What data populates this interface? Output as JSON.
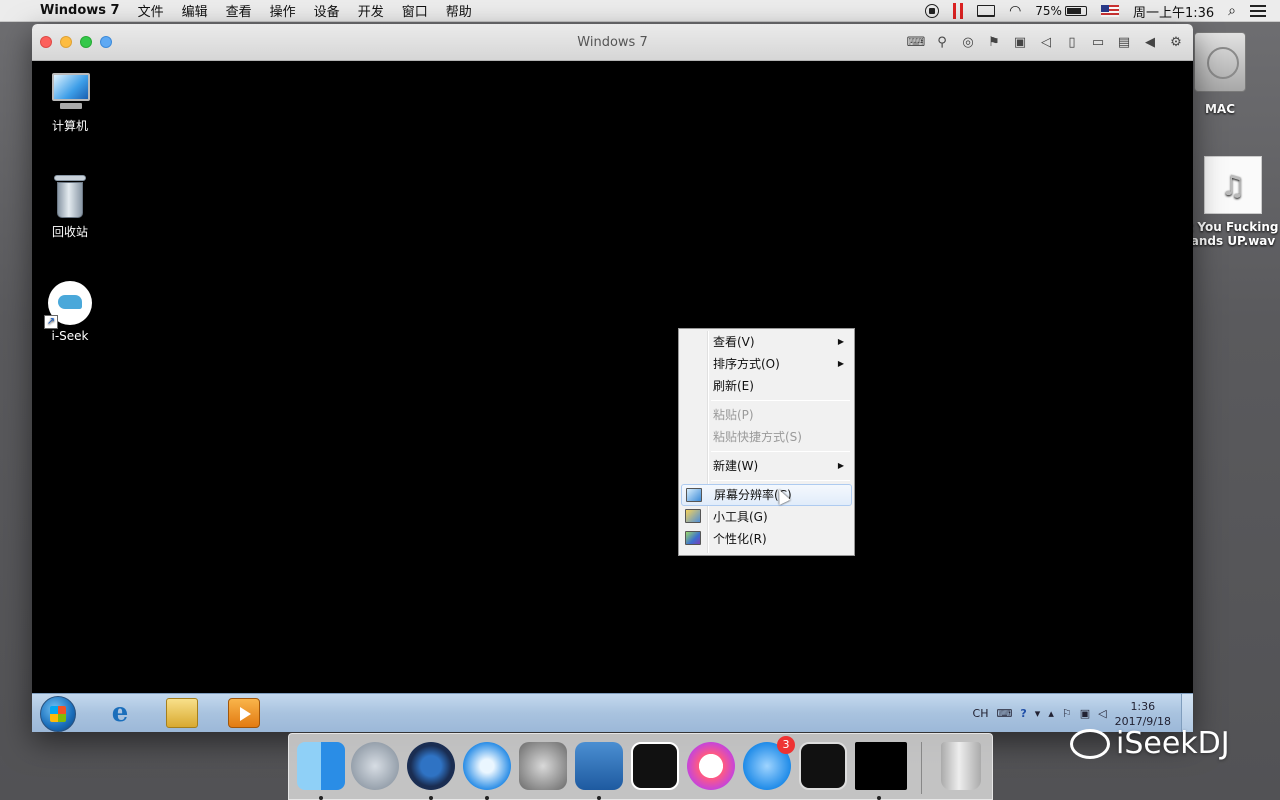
{
  "menubar": {
    "app_name": "Windows 7",
    "items": [
      "文件",
      "编辑",
      "查看",
      "操作",
      "设备",
      "开发",
      "窗口",
      "帮助"
    ],
    "battery_percent": "75%",
    "clock": "周一上午1:36"
  },
  "vm_window": {
    "title": "Windows 7"
  },
  "desktop_icons": [
    {
      "label": "计算机"
    },
    {
      "label": "回收站"
    },
    {
      "label": "i-Seek"
    }
  ],
  "context_menu": {
    "items": [
      {
        "label": "查看(V)",
        "submenu": true,
        "disabled": false
      },
      {
        "label": "排序方式(O)",
        "submenu": true,
        "disabled": false
      },
      {
        "label": "刷新(E)",
        "submenu": false,
        "disabled": false
      },
      {
        "label": "粘贴(P)",
        "submenu": false,
        "disabled": true
      },
      {
        "label": "粘贴快捷方式(S)",
        "submenu": false,
        "disabled": true
      },
      {
        "label": "新建(W)",
        "submenu": true,
        "disabled": false
      },
      {
        "label": "屏幕分辨率(C)",
        "submenu": false,
        "disabled": false,
        "highlighted": true
      },
      {
        "label": "小工具(G)",
        "submenu": false,
        "disabled": false
      },
      {
        "label": "个性化(R)",
        "submenu": false,
        "disabled": false
      }
    ]
  },
  "taskbar": {
    "lang": "CH",
    "time": "1:36",
    "date": "2017/9/18"
  },
  "mac_desktop": {
    "drive_label": "MAC",
    "file_label_line1": "t You Fucking",
    "file_label_line2": "ands UP.wav"
  },
  "dock": {
    "app_store_badge": "3"
  },
  "watermark": {
    "text": "iSeekDJ"
  }
}
